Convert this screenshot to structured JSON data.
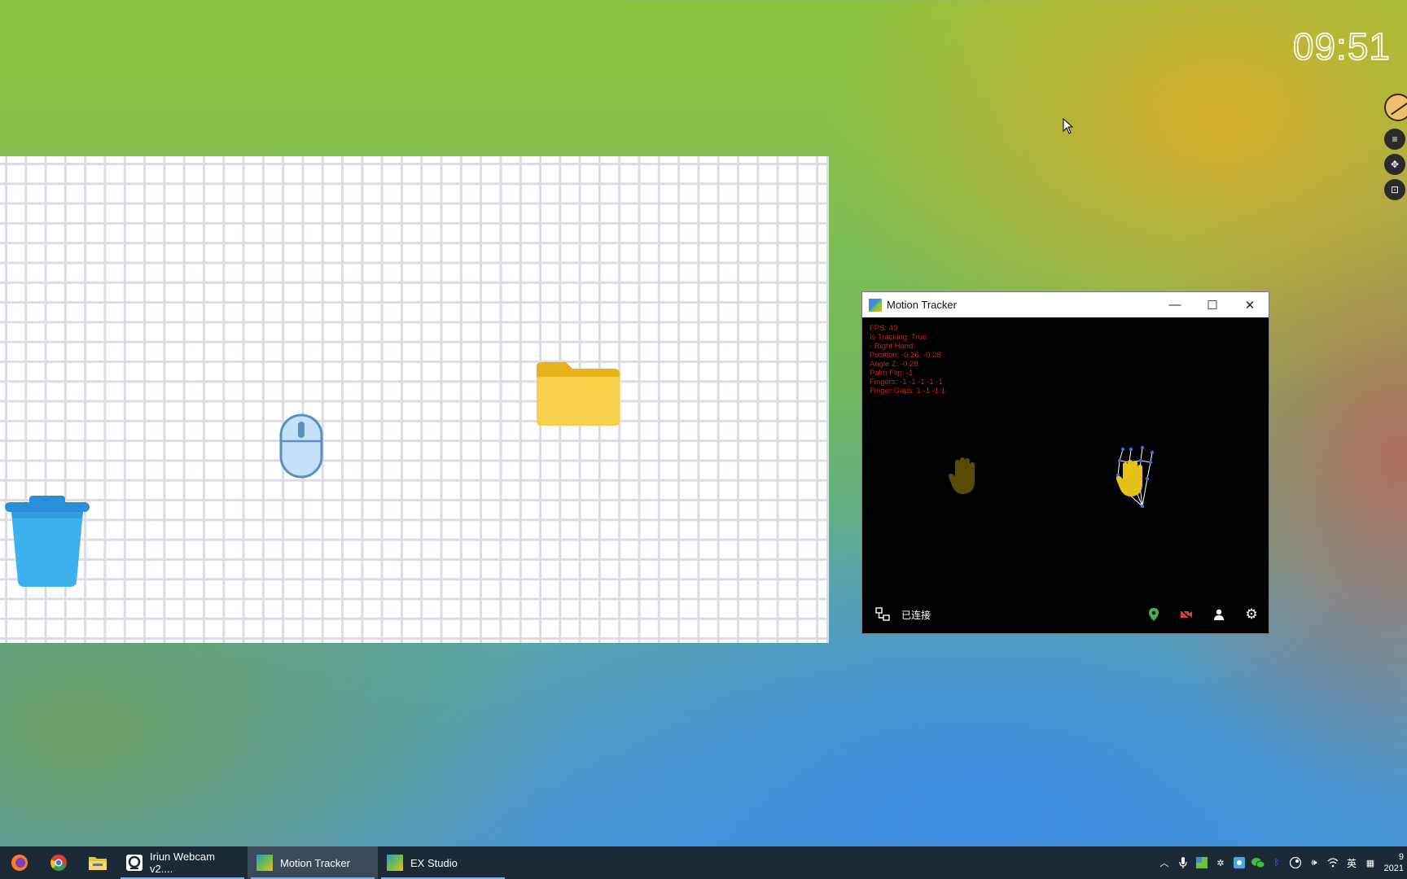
{
  "desktop": {
    "clock": "09:51"
  },
  "motion_tracker": {
    "title": "Motion Tracker",
    "stats": [
      "FPS: 49",
      "Is Tracking: True",
      "- Right Hand:",
      "Position: -0.26, -0.28",
      "Angle Z: -0.28",
      "Palm Flip: -1",
      "Fingers: -1 -1 -1 -1 -1",
      "Finger Gaps: 1 -1 -1 1"
    ],
    "status_label": "已连接",
    "colors": {
      "stats_text": "#c02424",
      "hand_active": "#e6c21a",
      "hand_inactive": "#5a4a08",
      "location_icon": "#4caf50",
      "camera_off_icon": "#d04040"
    }
  },
  "taskbar": {
    "apps": [
      {
        "label": "Iriun Webcam v2....",
        "icon": "iriun-icon"
      },
      {
        "label": "Motion Tracker",
        "icon": "motion-tracker-icon"
      },
      {
        "label": "EX Studio",
        "icon": "ex-studio-icon"
      }
    ],
    "ime_label": "英",
    "clock_line1": "9",
    "clock_line2": "2021"
  }
}
